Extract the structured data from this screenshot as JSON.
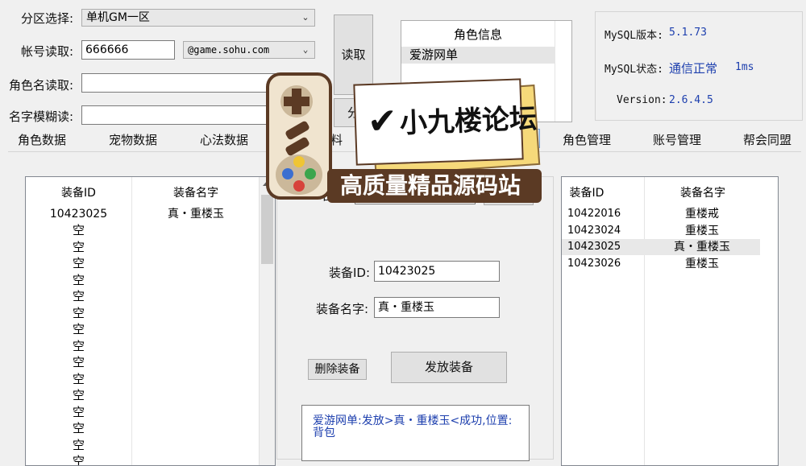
{
  "top": {
    "partition_label": "分区选择:",
    "partition_value": "单机GM一区",
    "account_label": "帐号读取:",
    "account_value": "666666",
    "domain_value": "@game.sohu.com",
    "charname_label": "角色名读取:",
    "fuzzy_label": "名字模糊读:",
    "read_button": "读取",
    "second_button": "分"
  },
  "role_info": {
    "header": "角色信息",
    "items": [
      "爱游网单"
    ]
  },
  "status": {
    "mysql_version_label": "MySQL版本:",
    "mysql_version_value": "5.1.73",
    "mysql_state_label": "MySQL状态:",
    "mysql_state_value": "通信正常",
    "mysql_latency": "1ms",
    "version_label": "Version:",
    "version_value": "2.6.4.5"
  },
  "tabs": {
    "role_data": "角色数据",
    "pet_data": "宠物数据",
    "mind_data": "心法数据",
    "partial": "料",
    "role_manage": "角色管理",
    "account_manage": "账号管理",
    "guild": "帮会同盟"
  },
  "left_grid": {
    "col_id": "装备ID",
    "col_name": "装备名字",
    "first_row": {
      "id": "10423025",
      "name": "真・重楼玉"
    },
    "empty_label": "空",
    "empty_count": 15
  },
  "center": {
    "partial_label": "名字",
    "equip_id_label": "装备ID:",
    "equip_id_value": "10423025",
    "equip_name_label": "装备名字:",
    "equip_name_value": "真・重楼玉",
    "delete_button": "删除装备",
    "send_button": "发放装备",
    "log_text": "爱游网单:发放>真・重楼玉<成功,位置:背包"
  },
  "right_grid": {
    "col_id": "装备ID",
    "col_name": "装备名字",
    "rows": [
      {
        "id": "10422016",
        "name": "重楼戒"
      },
      {
        "id": "10423024",
        "name": "重楼玉"
      },
      {
        "id": "10423025",
        "name": "真・重楼玉"
      },
      {
        "id": "10423026",
        "name": "重楼玉"
      }
    ]
  },
  "watermark": {
    "title": "小九楼论坛",
    "subtitle": "高质量精品源码站"
  },
  "colors": {
    "accent": "#1d3fae",
    "watermark_brown": "#5b3a24",
    "watermark_yellow": "#f6d97a"
  }
}
